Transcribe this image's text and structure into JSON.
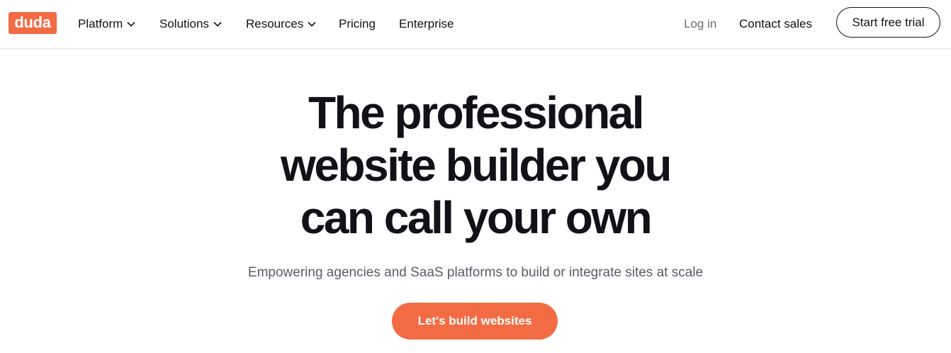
{
  "brand": {
    "logo_text": "duda",
    "color": "#f36b43"
  },
  "nav": {
    "platform": "Platform",
    "solutions": "Solutions",
    "resources": "Resources",
    "pricing": "Pricing",
    "enterprise": "Enterprise",
    "login": "Log in",
    "contact_sales": "Contact sales",
    "start_trial": "Start free trial"
  },
  "hero": {
    "title_line1": "The professional",
    "title_line2": "website builder you",
    "title_line3": "can call your own",
    "subtitle": "Empowering agencies and SaaS platforms to build or integrate sites at scale",
    "cta_label": "Let's build websites"
  },
  "icons": {
    "dropdown": "chevron-down-icon"
  }
}
